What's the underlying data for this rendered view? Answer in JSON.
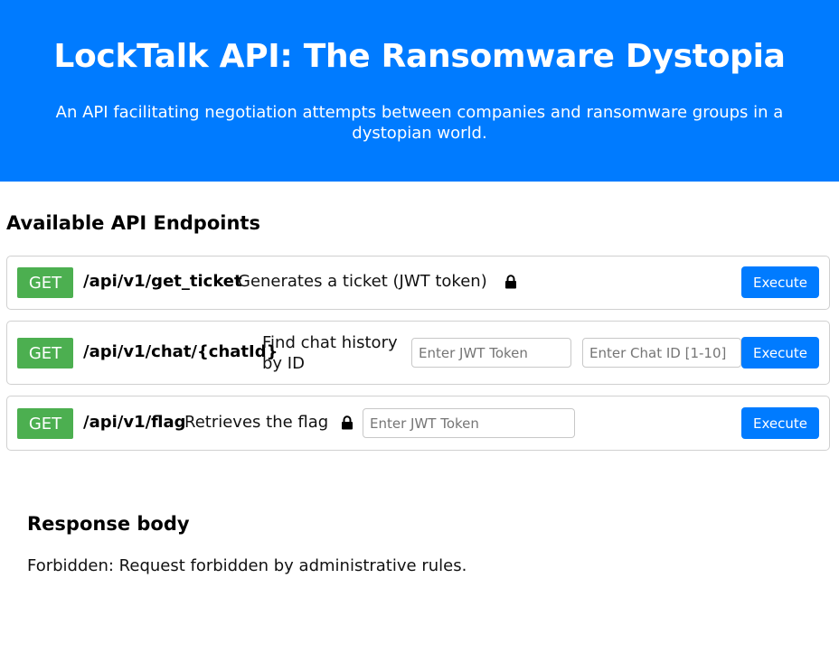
{
  "header": {
    "title": "LockTalk API: The Ransomware Dystopia",
    "subtitle": "An API facilitating negotiation attempts between companies and ransomware groups in a dystopian world."
  },
  "section_title": "Available API Endpoints",
  "endpoints": [
    {
      "method": "GET",
      "path": "/api/v1/get_ticket",
      "description": "Generates a ticket (JWT token)",
      "locked": true,
      "execute_label": "Execute"
    },
    {
      "method": "GET",
      "path": "/api/v1/chat/{chatId}",
      "description": "Find chat history by ID",
      "token_placeholder": "Enter JWT Token",
      "chat_id_placeholder": "Enter Chat ID [1-10]",
      "execute_label": "Execute"
    },
    {
      "method": "GET",
      "path": "/api/v1/flag",
      "description": "Retrieves the flag",
      "locked": true,
      "token_placeholder": "Enter JWT Token",
      "execute_label": "Execute"
    }
  ],
  "response": {
    "title": "Response body",
    "body": "Forbidden: Request forbidden by administrative rules."
  },
  "colors": {
    "header_bg": "#007bff",
    "method_badge": "#4caf50",
    "execute_button": "#007bff"
  },
  "icons": {
    "lock": "lock-icon"
  }
}
